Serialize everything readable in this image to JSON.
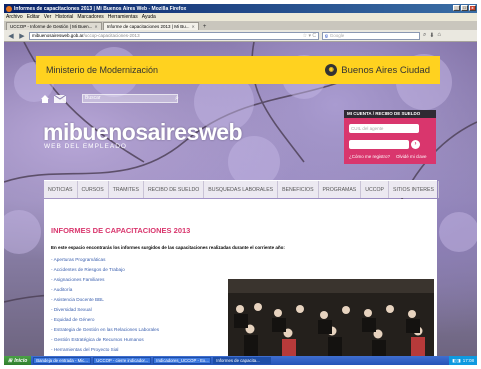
{
  "window": {
    "title": "Informes de capacitaciones 2013 | Mi Buenos Aires Web - Mozilla Firefox",
    "controls": [
      "_",
      "□",
      "x"
    ]
  },
  "menu": [
    "Archivo",
    "Editar",
    "Ver",
    "Historial",
    "Marcadores",
    "Herramientas",
    "Ayuda"
  ],
  "tabs": [
    {
      "label": "UCCOP - Informe de Gestión | Mi Buen..."
    },
    {
      "label": "Informe de capacitaciones 2013 | Mi Bu..."
    }
  ],
  "newtab": "+",
  "nav": {
    "url_host": "mibuenosairesweb.gob.ar",
    "url_path": "/uccop-capacitaciones-2013",
    "search_placeholder": "Google",
    "search_engine": "g"
  },
  "site": {
    "ministry": "Ministerio de Modernización",
    "city": "Buenos Aires Ciudad",
    "search_placeholder": "Buscar",
    "logo": "mibuenosairesweb",
    "logo_sub": "WEB DEL EMPLEADO",
    "account": {
      "title": "MI CUENTA / RECIBO DE SUELDO",
      "cuil_placeholder": "CUIL del agente",
      "forgot": "¿Cómo me registro?",
      "register": "Olvidé mi clave"
    },
    "nav": [
      "NOTICIAS",
      "CURSOS",
      "TRAMITES",
      "RECIBO DE SUELDO",
      "BUSQUEDAS LABORALES",
      "BENEFICIOS",
      "PROGRAMAS",
      "UCCOP",
      "SITIOS INTERES"
    ],
    "page_title": "INFORMES DE CAPACITACIONES 2013",
    "intro": "En este espacio encontrarás los informes surgidos de las capacitaciones realizadas durante el corriente año:",
    "reports": [
      "- Aperturas Programáticas",
      "- Accidentes de Riesgos de Trabajo",
      "- Asignaciones Familiares",
      "- Auditoría",
      "- Asistencia Docente BBL",
      "- Diversidad Sexual",
      "- Equidad de Género",
      "- Estrategia de Gestión en las Relaciones Laborales",
      "- Gestión Estratégica de Recursos Humanos",
      "- Herramientas del Proyecto Sial"
    ]
  },
  "taskbar": {
    "start": "Inicio",
    "tasks": [
      "Bandeja de entrada - Mic...",
      "UCCOP - cierre indicador...",
      "Indicadores_UCCOP - Ex...",
      "Informes de capacita..."
    ],
    "clock": "17:08"
  }
}
